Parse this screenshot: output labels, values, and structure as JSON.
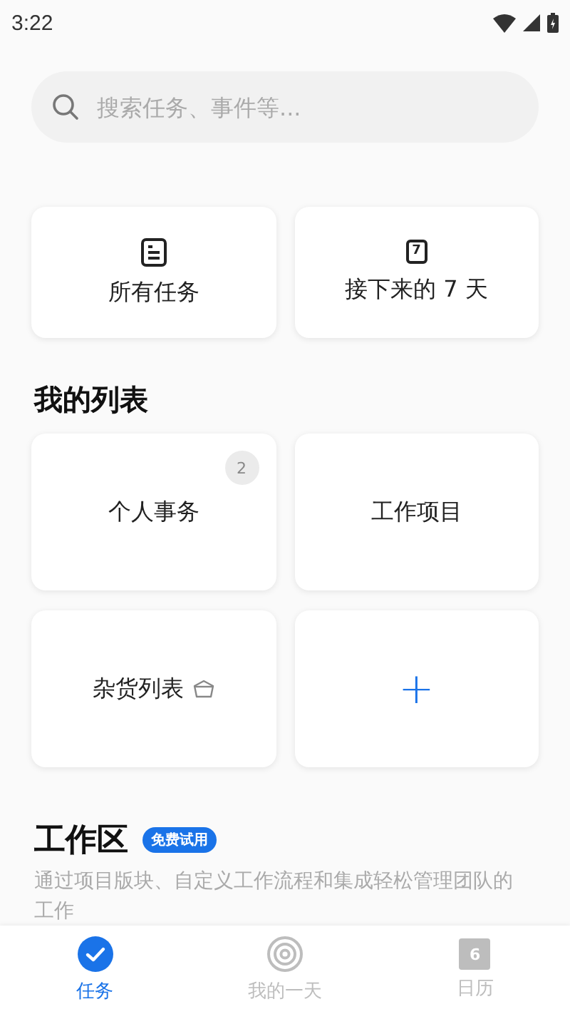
{
  "status_bar": {
    "time": "3:22"
  },
  "search": {
    "placeholder": "搜索任务、事件等..."
  },
  "shortcuts": [
    {
      "kind": "all",
      "label": "所有任务"
    },
    {
      "kind": "calendar",
      "label": "接下来的 7 天",
      "icon_text": "7"
    }
  ],
  "my_lists": {
    "title": "我的列表",
    "items": [
      {
        "kind": "list",
        "label": "个人事务",
        "count": "2"
      },
      {
        "kind": "list",
        "label": "工作项目"
      },
      {
        "kind": "basket",
        "label": "杂货列表"
      },
      {
        "kind": "add",
        "label": "+"
      }
    ]
  },
  "workspace": {
    "title": "工作区",
    "badge": "免费试用",
    "description": "通过项目版块、自定义工作流程和集成轻松管理团队的工作"
  },
  "tabs": [
    {
      "kind": "check",
      "label": "任务",
      "selected": true
    },
    {
      "kind": "target",
      "label": "我的一天",
      "selected": false
    },
    {
      "kind": "calendar",
      "label": "日历",
      "icon_text": "6",
      "selected": false
    }
  ]
}
